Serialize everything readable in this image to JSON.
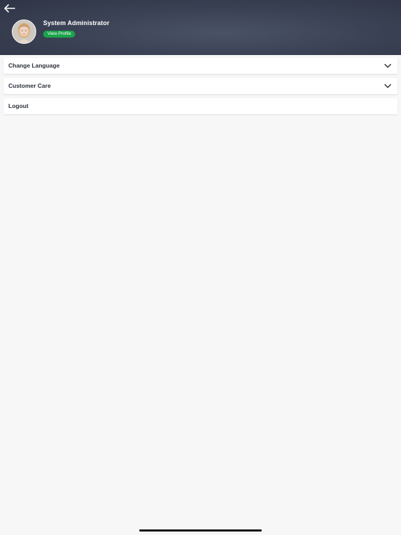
{
  "header": {
    "back_icon": "arrow-left-icon",
    "avatar_icon": "user-avatar",
    "user_name": "System Administrator",
    "view_profile_label": "View Profile",
    "view_profile_color": "#1aa34a"
  },
  "menu": {
    "items": [
      {
        "label": "Change Language",
        "icon": "chevron-down-icon",
        "expandable": true
      },
      {
        "label": "Customer Care",
        "icon": "chevron-down-icon",
        "expandable": true
      },
      {
        "label": "Logout",
        "expandable": false
      }
    ]
  }
}
